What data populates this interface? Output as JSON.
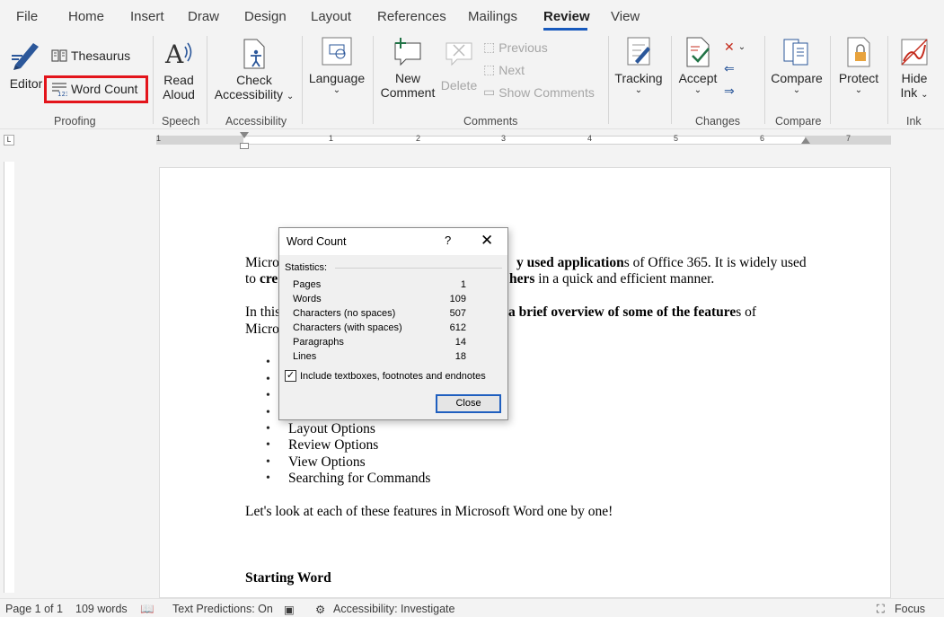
{
  "tabs": [
    "File",
    "Home",
    "Insert",
    "Draw",
    "Design",
    "Layout",
    "References",
    "Mailings",
    "Review",
    "View"
  ],
  "active_tab": "Review",
  "ribbon": {
    "editor": "Editor",
    "thesaurus": "Thesaurus",
    "word_count": "Word Count",
    "read_aloud_1": "Read",
    "read_aloud_2": "Aloud",
    "check_access_1": "Check",
    "check_access_2": "Accessibility",
    "language": "Language",
    "new_comment_1": "New",
    "new_comment_2": "Comment",
    "delete": "Delete",
    "previous": "Previous",
    "next": "Next",
    "show_comments": "Show Comments",
    "tracking": "Tracking",
    "accept": "Accept",
    "compare": "Compare",
    "protect": "Protect",
    "hide_ink_1": "Hide",
    "hide_ink_2": "Ink",
    "groups": {
      "proofing": "Proofing",
      "speech": "Speech",
      "accessibility": "Accessibility",
      "comments": "Comments",
      "changes": "Changes",
      "compare": "Compare",
      "ink": "Ink"
    }
  },
  "ruler_numbers": [
    "1",
    "1",
    "2",
    "3",
    "4",
    "5",
    "6",
    "7"
  ],
  "document": {
    "line1_a": "Micro",
    "line1_b": "y used application",
    "line1_c": "s of Office 365. It is widely used",
    "line2_a": "to ",
    "line2_b": "cre",
    "line2_c": "hers",
    "line2_d": " in a quick and efficient manner.",
    "line3_a": "In this",
    "line3_b": " a brief overview of some of the feature",
    "line3_c": "s of",
    "line4_a": "Micro",
    "bullets": [
      "Layout Options",
      "Review Options",
      "View Options",
      "Searching for Commands"
    ],
    "closing": "Let's look at each of these features in Microsoft Word one by one!",
    "heading": "Starting Word"
  },
  "dialog": {
    "title": "Word Count",
    "help": "?",
    "close_x": "✕",
    "statistics_label": "Statistics:",
    "stats": [
      {
        "label": "Pages",
        "value": "1"
      },
      {
        "label": "Words",
        "value": "109"
      },
      {
        "label": "Characters (no spaces)",
        "value": "507"
      },
      {
        "label": "Characters (with spaces)",
        "value": "612"
      },
      {
        "label": "Paragraphs",
        "value": "14"
      },
      {
        "label": "Lines",
        "value": "18"
      }
    ],
    "include_label": "Include textboxes, footnotes and endnotes",
    "include_checked": true,
    "close_button": "Close"
  },
  "status": {
    "page": "Page 1 of 1",
    "words": "109 words",
    "predictions": "Text Predictions: On",
    "accessibility": "Accessibility: Investigate",
    "focus": "Focus"
  },
  "colors": {
    "accent": "#185abd",
    "highlight": "#e3141b",
    "icon_blue": "#2b579a"
  }
}
